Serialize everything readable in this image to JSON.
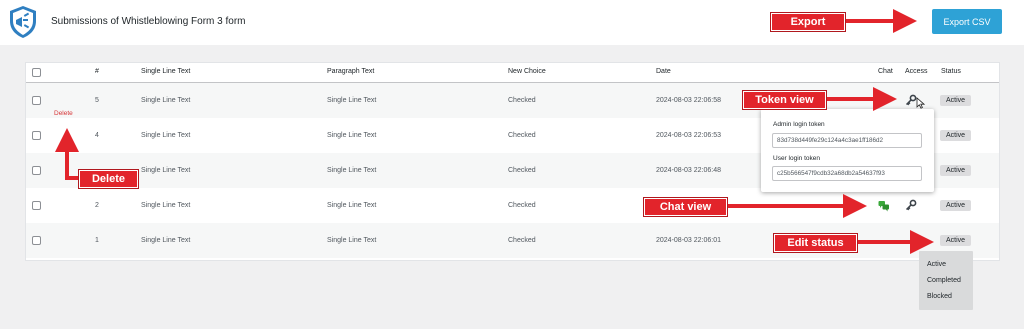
{
  "header": {
    "title": "Submissions of Whistleblowing Form 3 form",
    "export_label": "Export CSV"
  },
  "table": {
    "columns": [
      "#",
      "Single Line Text",
      "Paragraph Text",
      "New Choice",
      "Date",
      "Chat",
      "Access",
      "Status"
    ],
    "rows": [
      {
        "num": "5",
        "single": "Single Line Text",
        "paragraph": "Single Line Text",
        "choice": "Checked",
        "date": "2024-08-03 22:06:58",
        "status": "Active"
      },
      {
        "num": "4",
        "single": "Single Line Text",
        "paragraph": "Single Line Text",
        "choice": "Checked",
        "date": "2024-08-03 22:06:53",
        "status": "Active"
      },
      {
        "num": "3",
        "single": "Single Line Text",
        "paragraph": "Single Line Text",
        "choice": "Checked",
        "date": "2024-08-03 22:06:48",
        "status": "Active"
      },
      {
        "num": "2",
        "single": "Single Line Text",
        "paragraph": "Single Line Text",
        "choice": "Checked",
        "date": "",
        "status": "Active"
      },
      {
        "num": "1",
        "single": "Single Line Text",
        "paragraph": "Single Line Text",
        "choice": "Checked",
        "date": "2024-08-03 22:06:01",
        "status": "Active"
      }
    ],
    "delete_label": "Delete"
  },
  "token_popup": {
    "admin_label": "Admin login token",
    "admin_value": "83d738d449fe29c124a4c3ae1ff186d2",
    "user_label": "User login token",
    "user_value": "c25b566547f9cdb32a68db2a54637f93"
  },
  "status_dropdown": {
    "options": [
      "Active",
      "Completed",
      "Blocked"
    ]
  },
  "callouts": {
    "export": "Export",
    "token_view": "Token view",
    "delete": "Delete",
    "chat_view": "Chat view",
    "edit_status": "Edit status"
  },
  "colors": {
    "accent": "#2ea2d6",
    "callout_red": "#e2242b",
    "chat_green": "#3aa83a",
    "delete_red": "#d63638"
  },
  "icons": {
    "logo": "shield-megaphone-logo",
    "access": "key-icon",
    "chat": "chat-bubbles-icon"
  }
}
